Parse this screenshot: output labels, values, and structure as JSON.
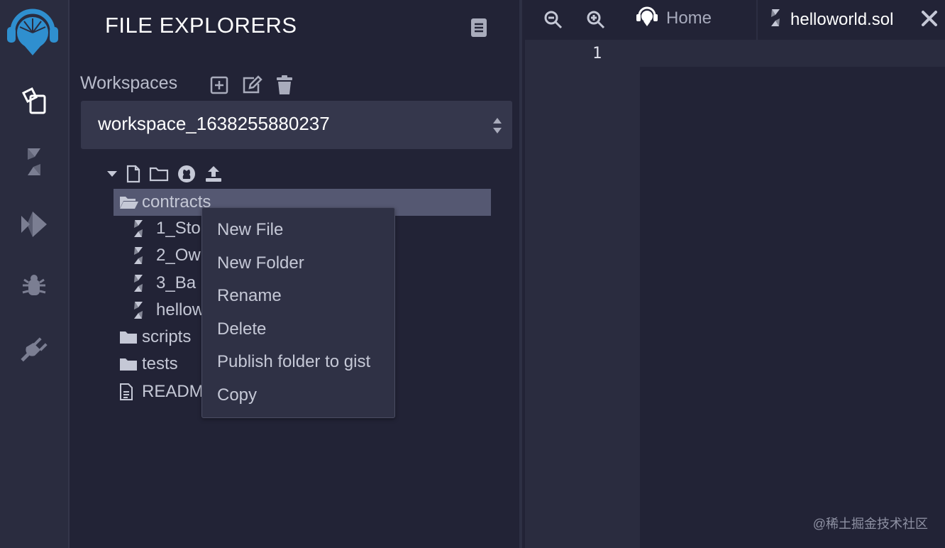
{
  "rail": {
    "icons": [
      "remix-logo",
      "file-explorer-icon",
      "solidity-compiler-icon",
      "deploy-run-icon",
      "debugger-icon",
      "plugin-manager-icon"
    ]
  },
  "explorer": {
    "title": "FILE EXPLORERS",
    "workspaces_label": "Workspaces",
    "workspace_selected": "workspace_1638255880237",
    "tree": [
      {
        "label": "contracts",
        "type": "folder-open"
      },
      {
        "label": "1_Sto",
        "type": "sol"
      },
      {
        "label": "2_Ow",
        "type": "sol"
      },
      {
        "label": "3_Ba",
        "type": "sol"
      },
      {
        "label": "hellow",
        "type": "sol"
      },
      {
        "label": "scripts",
        "type": "folder"
      },
      {
        "label": "tests",
        "type": "folder"
      },
      {
        "label": "READM",
        "type": "file"
      }
    ]
  },
  "context_menu": {
    "items": [
      "New File",
      "New Folder",
      "Rename",
      "Delete",
      "Publish folder to gist",
      "Copy"
    ]
  },
  "tabs": {
    "home": "Home",
    "file": "helloworld.sol"
  },
  "editor": {
    "line_numbers": [
      "1"
    ]
  },
  "watermark": "@稀土掘金技术社区",
  "colors": {
    "background": "#222336",
    "rail": "#2a2c3f",
    "selection": "#555872",
    "accent_logo": "#2f8fcf"
  }
}
